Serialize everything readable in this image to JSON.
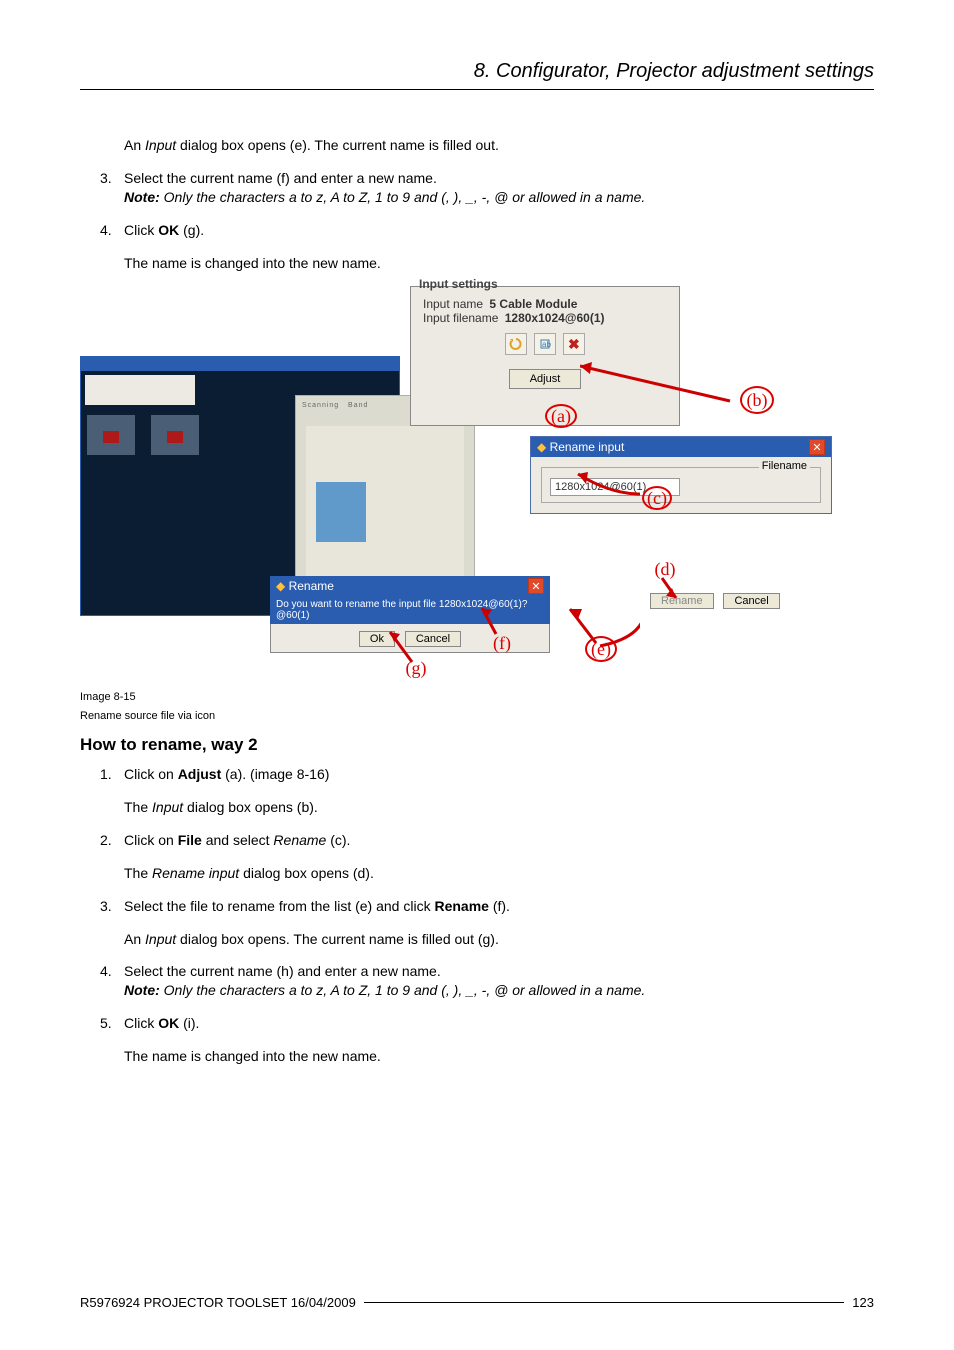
{
  "chapter_title": "8. Configurator, Projector adjustment settings",
  "intro_text": "An Input dialog box opens (e). The current name is filled out.",
  "step3": {
    "num": "3.",
    "line1": "Select the current name (f) and enter a new name.",
    "note": "Only the characters a to z, A to Z, 1 to 9 and (, ), _, -, @ or allowed in a name."
  },
  "step4": {
    "num": "4.",
    "text_a": "Click ",
    "bold": "OK",
    "text_b": " (g)."
  },
  "result_text": "The name is changed into the new name.",
  "figure": {
    "input_settings_label": "Input settings",
    "line1_label": "Input name",
    "line1_value": "5 Cable Module",
    "line2_label": "Input filename",
    "line2_value": "1280x1024@60(1)",
    "adjust_btn": "Adjust",
    "rename_input_title": "Rename input",
    "filename_label": "Filename",
    "filename_value": "1280x1024@60(1)",
    "rename_dlg_title": "Rename",
    "rename_dlg_question": "Do you want to rename the input file 1280x1024@60(1)?  @60(1)",
    "ok_btn": "Ok",
    "cancel_btn": "Cancel",
    "rename_btn": "Rename",
    "cancel2_btn": "Cancel",
    "labels": {
      "a": "(a)",
      "b": "(b)",
      "c": "(c)",
      "d": "(d)",
      "e": "(e)",
      "f": "(f)",
      "g": "(g)"
    }
  },
  "caption_l1": "Image 8-15",
  "caption_l2": "Rename source file via icon",
  "section_heading": "How to rename, way 2",
  "steps2": {
    "s1": {
      "num": "1.",
      "a": "Click on ",
      "b": "Adjust",
      "c": " (a). (image 8-16)",
      "sub": "The Input dialog box opens (b)."
    },
    "s2": {
      "num": "2.",
      "a": "Click on ",
      "b": "File",
      "c": " and select ",
      "d": "Rename",
      "e": " (c).",
      "sub": "The Rename input dialog box opens (d)."
    },
    "s3": {
      "num": "3.",
      "a": "Select the file to rename from the list (e) and click ",
      "b": "Rename",
      "c": " (f).",
      "sub": "An Input dialog box opens. The current name is filled out (g)."
    },
    "s4": {
      "num": "4.",
      "a": "Select the current name (h) and enter a new name.",
      "note": "Only the characters a to z, A to Z, 1 to 9 and (, ), _, -, @ or allowed in a name."
    },
    "s5": {
      "num": "5.",
      "a": "Click ",
      "b": "OK",
      "c": " (i).",
      "sub": "The name is changed into the new name."
    }
  },
  "note_label": "Note: ",
  "input_word": "Input",
  "rename_input_word": "Rename input",
  "footer_left": "R5976924  PROJECTOR TOOLSET  16/04/2009",
  "footer_right": "123"
}
